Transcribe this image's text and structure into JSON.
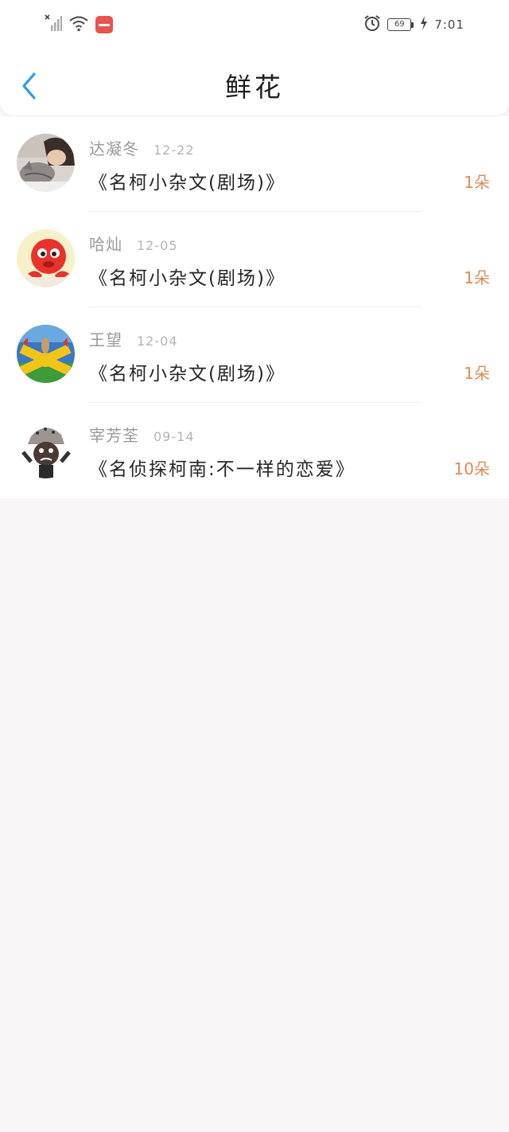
{
  "status_bar": {
    "battery_level": "69",
    "time": "7:01",
    "icons": [
      "no-signal-icon",
      "wifi-icon",
      "app-notification-icon",
      "alarm-icon",
      "battery-icon",
      "charging-icon"
    ]
  },
  "header": {
    "back_icon": "chevron-left-icon",
    "title": "鲜花"
  },
  "colors": {
    "accent_blue": "#2c9be6",
    "count_orange": "#e08a52",
    "page_bg": "#f8f6f6"
  },
  "items": [
    {
      "name": "达凝冬",
      "date": "12-22",
      "book": "《名柯小杂文(剧场)》",
      "count": "1朵"
    },
    {
      "name": "哈灿",
      "date": "12-05",
      "book": "《名柯小杂文(剧场)》",
      "count": "1朵"
    },
    {
      "name": "王望",
      "date": "12-04",
      "book": "《名柯小杂文(剧场)》",
      "count": "1朵"
    },
    {
      "name": "宰芳荃",
      "date": "09-14",
      "book": "《名侦探柯南:不一样的恋爱》",
      "count": "10朵"
    }
  ]
}
